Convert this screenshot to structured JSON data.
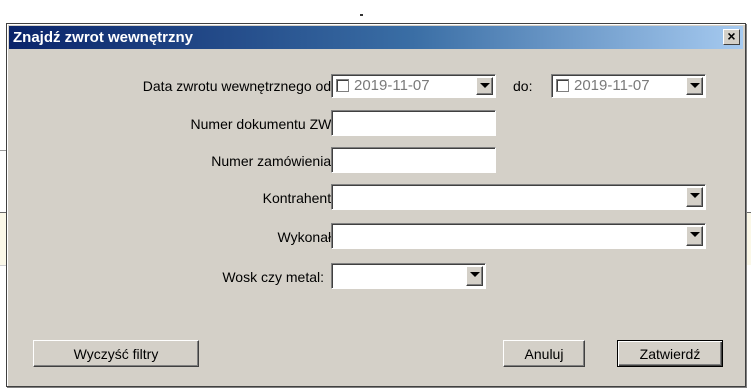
{
  "dialog": {
    "title": "Znajdź zwrot wewnętrzny",
    "close_label": "×"
  },
  "form": {
    "date_from_label": "Data zwrotu wewnętrznego od:",
    "date_from_value": "2019-11-07",
    "date_to_label": "do:",
    "date_to_value": "2019-11-07",
    "doc_number_label": "Numer dokumentu ZW:",
    "doc_number_value": "",
    "order_number_label": "Numer zamówienia:",
    "order_number_value": "",
    "contractor_label": "Kontrahent:",
    "contractor_value": "",
    "performed_label": "Wykonał:",
    "performed_value": "",
    "material_label": "Wosk czy metal:",
    "material_value": ""
  },
  "buttons": {
    "clear": "Wyczyść filtry",
    "cancel": "Anuluj",
    "confirm": "Zatwierdź"
  }
}
